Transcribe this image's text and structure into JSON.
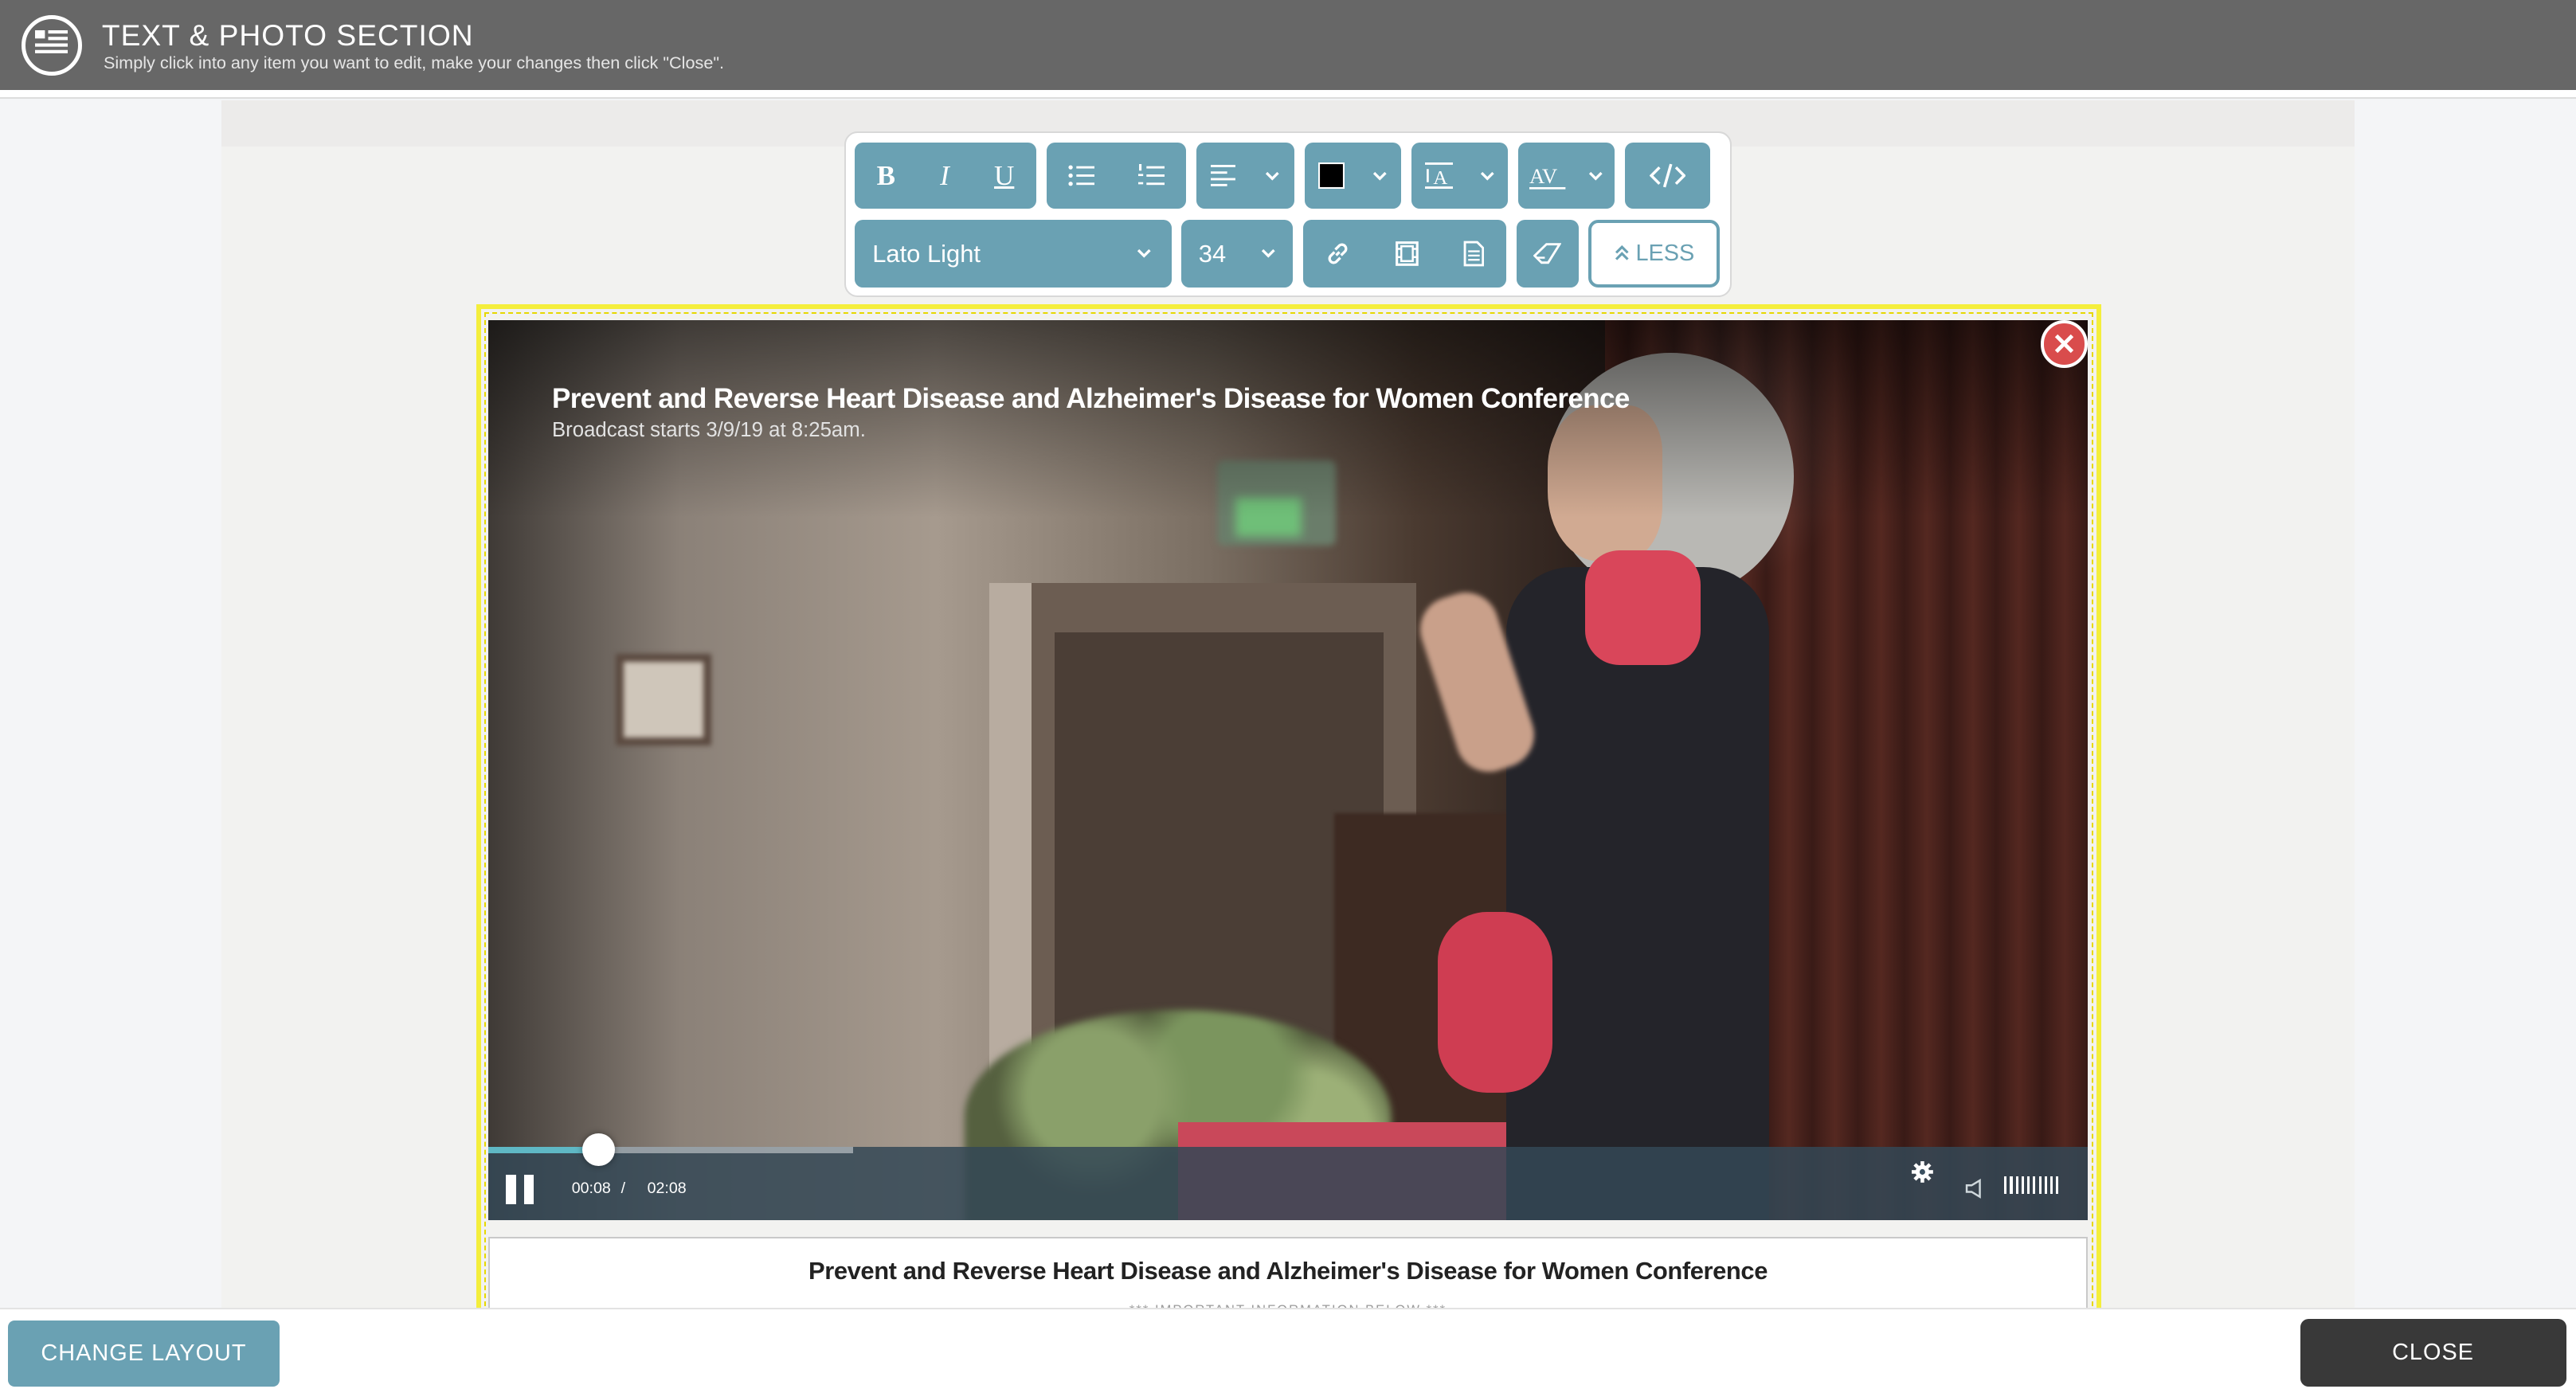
{
  "header": {
    "title": "TEXT & PHOTO SECTION",
    "subtitle": "Simply click into any item you want to edit, make your changes then click \"Close\".",
    "icon": "section-list-icon"
  },
  "toolbar": {
    "row1": [
      {
        "name": "bold-button",
        "label": "B",
        "icon": "bold-icon"
      },
      {
        "name": "italic-button",
        "label": "I",
        "icon": "italic-icon"
      },
      {
        "name": "underline-button",
        "label": "U",
        "icon": "underline-icon"
      },
      {
        "name": "bullet-list-button",
        "icon": "bullet-list-icon"
      },
      {
        "name": "numbered-list-button",
        "icon": "numbered-list-icon"
      },
      {
        "name": "align-dropdown",
        "icon": "align-left-icon"
      },
      {
        "name": "text-color-dropdown",
        "icon": "color-swatch-icon",
        "color": "#000000"
      },
      {
        "name": "font-size-style-dropdown",
        "icon": "text-height-icon"
      },
      {
        "name": "letter-spacing-dropdown",
        "icon": "letter-spacing-icon"
      },
      {
        "name": "code-view-button",
        "icon": "code-icon"
      }
    ],
    "font_family": "Lato Light",
    "font_size": "34",
    "row2_icons": [
      "link-icon",
      "film-icon",
      "document-icon",
      "eraser-icon"
    ],
    "less_label": "LESS",
    "accent_color": "#6aa1b3"
  },
  "video": {
    "title": "Prevent and Reverse Heart Disease and Alzheimer's Disease for Women Conference",
    "subtitle": "Broadcast starts 3/9/19 at 8:25am.",
    "current_time": "00:08",
    "separator": "/",
    "duration": "02:08",
    "buffered_fraction": 0.228,
    "played_fraction": 0.069,
    "controls_icons": [
      "pause-icon",
      "gear-icon",
      "volume-icon"
    ]
  },
  "caption": {
    "title": "Prevent and Reverse Heart Disease and Alzheimer's Disease for Women Conference",
    "subtitle": "*** IMPORTANT INFORMATION BELOW ***"
  },
  "footer": {
    "change_layout_label": "CHANGE LAYOUT",
    "close_label": "CLOSE"
  }
}
